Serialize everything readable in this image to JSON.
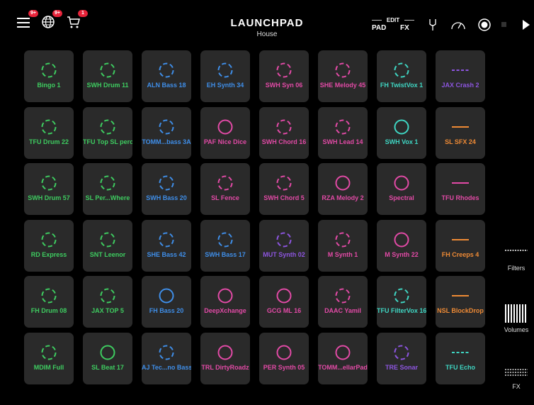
{
  "header": {
    "title": "LAUNCHPAD",
    "subtitle": "House",
    "menu_badge": "9+",
    "globe_badge": "9+",
    "cart_badge": "1",
    "mode_edit": "EDIT",
    "mode_pad": "PAD",
    "mode_fx": "FX"
  },
  "side_panel": {
    "filters_label": "Filters",
    "volumes_label": "Volumes",
    "fx_label": "FX"
  },
  "colors": {
    "green": "#3ecc60",
    "blue": "#3f8ee8",
    "pink": "#e24aa6",
    "teal": "#3fd6c3",
    "purple": "#8d55e0",
    "orange": "#ee8a35",
    "pad_bg": "#2a2a2a"
  },
  "pads": [
    [
      {
        "label": "Bingo 1",
        "color": "green",
        "icon": "dashed-circle"
      },
      {
        "label": "SWH Drum 11",
        "color": "green",
        "icon": "dashed-circle"
      },
      {
        "label": "ALN Bass 18",
        "color": "blue",
        "icon": "dashed-circle"
      },
      {
        "label": "EH Synth 34",
        "color": "blue",
        "icon": "dashed-circle"
      },
      {
        "label": "SWH Syn 06",
        "color": "pink",
        "icon": "dashed-circle"
      },
      {
        "label": "SHE Melody 45",
        "color": "pink",
        "icon": "dashed-circle"
      },
      {
        "label": "FH TwistVox 1",
        "color": "teal",
        "icon": "dashed-circle"
      },
      {
        "label": "JAX Crash 2",
        "color": "purple",
        "icon": "dashed-line"
      }
    ],
    [
      {
        "label": "TFU Drum 22",
        "color": "green",
        "icon": "dashed-circle"
      },
      {
        "label": "TFU Top SL perc",
        "color": "green",
        "icon": "dashed-circle"
      },
      {
        "label": "TOMM...bass 3A",
        "color": "blue",
        "icon": "dashed-circle"
      },
      {
        "label": "PAF Nice Dice",
        "color": "pink",
        "icon": "solid-circle"
      },
      {
        "label": "SWH Chord 16",
        "color": "pink",
        "icon": "dashed-circle"
      },
      {
        "label": "SWH Lead 14",
        "color": "pink",
        "icon": "dashed-circle"
      },
      {
        "label": "SWH Vox 1",
        "color": "teal",
        "icon": "solid-circle"
      },
      {
        "label": "SL SFX 24",
        "color": "orange",
        "icon": "solid-line"
      }
    ],
    [
      {
        "label": "SWH Drum 57",
        "color": "green",
        "icon": "dashed-circle"
      },
      {
        "label": "SL Per...Where",
        "color": "green",
        "icon": "dashed-circle"
      },
      {
        "label": "SWH Bass 20",
        "color": "blue",
        "icon": "dashed-circle"
      },
      {
        "label": "SL Fence",
        "color": "pink",
        "icon": "dashed-circle"
      },
      {
        "label": "SWH Chord 5",
        "color": "pink",
        "icon": "dashed-circle"
      },
      {
        "label": "RZA Melody 2",
        "color": "pink",
        "icon": "solid-circle"
      },
      {
        "label": "Spectral",
        "color": "pink",
        "icon": "solid-circle"
      },
      {
        "label": "TFU Rhodes",
        "color": "pink",
        "icon": "solid-line"
      }
    ],
    [
      {
        "label": "RD Express",
        "color": "green",
        "icon": "dashed-circle"
      },
      {
        "label": "SNT Leenor",
        "color": "green",
        "icon": "dashed-circle"
      },
      {
        "label": "SHE Bass 42",
        "color": "blue",
        "icon": "dashed-circle"
      },
      {
        "label": "SWH Bass 17",
        "color": "blue",
        "icon": "dashed-circle"
      },
      {
        "label": "MUT Synth 02",
        "color": "purple",
        "icon": "dashed-circle"
      },
      {
        "label": "M Synth 1",
        "color": "pink",
        "icon": "dashed-circle"
      },
      {
        "label": "M Synth 22",
        "color": "pink",
        "icon": "solid-circle"
      },
      {
        "label": "FH Creeps 4",
        "color": "orange",
        "icon": "solid-line"
      }
    ],
    [
      {
        "label": "FH Drum 08",
        "color": "green",
        "icon": "dashed-circle"
      },
      {
        "label": "JAX TOP 5",
        "color": "green",
        "icon": "dashed-circle"
      },
      {
        "label": "FH Bass 20",
        "color": "blue",
        "icon": "solid-circle"
      },
      {
        "label": "DeepXchange",
        "color": "pink",
        "icon": "solid-circle"
      },
      {
        "label": "GCG ML 16",
        "color": "pink",
        "icon": "solid-circle"
      },
      {
        "label": "DAAC Yamil",
        "color": "pink",
        "icon": "dashed-circle"
      },
      {
        "label": "TFU FilterVox 16",
        "color": "teal",
        "icon": "dashed-circle"
      },
      {
        "label": "NSL BlockDrop",
        "color": "orange",
        "icon": "solid-line"
      }
    ],
    [
      {
        "label": "MDIM Full",
        "color": "green",
        "icon": "dashed-circle"
      },
      {
        "label": "SL Beat 17",
        "color": "green",
        "icon": "solid-circle"
      },
      {
        "label": "AJ Tec...no Bass",
        "color": "blue",
        "icon": "dashed-circle"
      },
      {
        "label": "TRL DirtyRoadz",
        "color": "pink",
        "icon": "solid-circle"
      },
      {
        "label": "PER Synth 05",
        "color": "pink",
        "icon": "solid-circle"
      },
      {
        "label": "TOMM...ellarPad",
        "color": "pink",
        "icon": "solid-circle"
      },
      {
        "label": "TRE Sonar",
        "color": "purple",
        "icon": "dashed-circle"
      },
      {
        "label": "TFU Echo",
        "color": "teal",
        "icon": "dashed-line"
      }
    ]
  ]
}
